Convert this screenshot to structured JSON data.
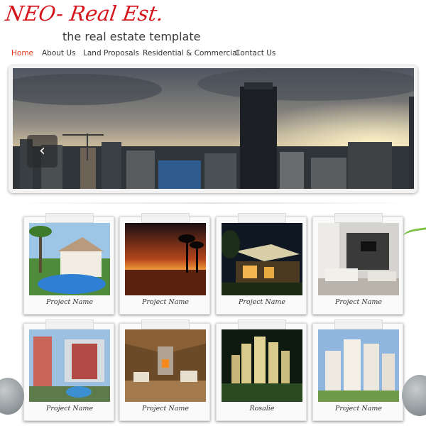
{
  "site": {
    "logo": "NEO- Real Est.",
    "tagline": "the real estate template"
  },
  "nav": {
    "items": [
      {
        "label": "Home",
        "active": true
      },
      {
        "label": "About Us",
        "active": false
      },
      {
        "label": "Land Proposals",
        "active": false
      },
      {
        "label": "Residential & Commercial",
        "active": false
      },
      {
        "label": "Contact Us",
        "active": false
      }
    ]
  },
  "slider": {
    "prev_icon": "chevron-left-icon"
  },
  "projects": [
    {
      "caption": "Project Name",
      "photo": "pool-villa"
    },
    {
      "caption": "Project Name",
      "photo": "sunset-palms"
    },
    {
      "caption": "Project Name",
      "photo": "night-resort"
    },
    {
      "caption": "Project Name",
      "photo": "living-room"
    },
    {
      "caption": "Project Name",
      "photo": "apartment-complex"
    },
    {
      "caption": "Project Name",
      "photo": "wooden-pavilion"
    },
    {
      "caption": "Rosalie",
      "photo": "tower-model"
    },
    {
      "caption": "Project Name",
      "photo": "residential-towers"
    }
  ],
  "colors": {
    "accent": "#d4161c",
    "nav_active": "#e03b1f"
  }
}
